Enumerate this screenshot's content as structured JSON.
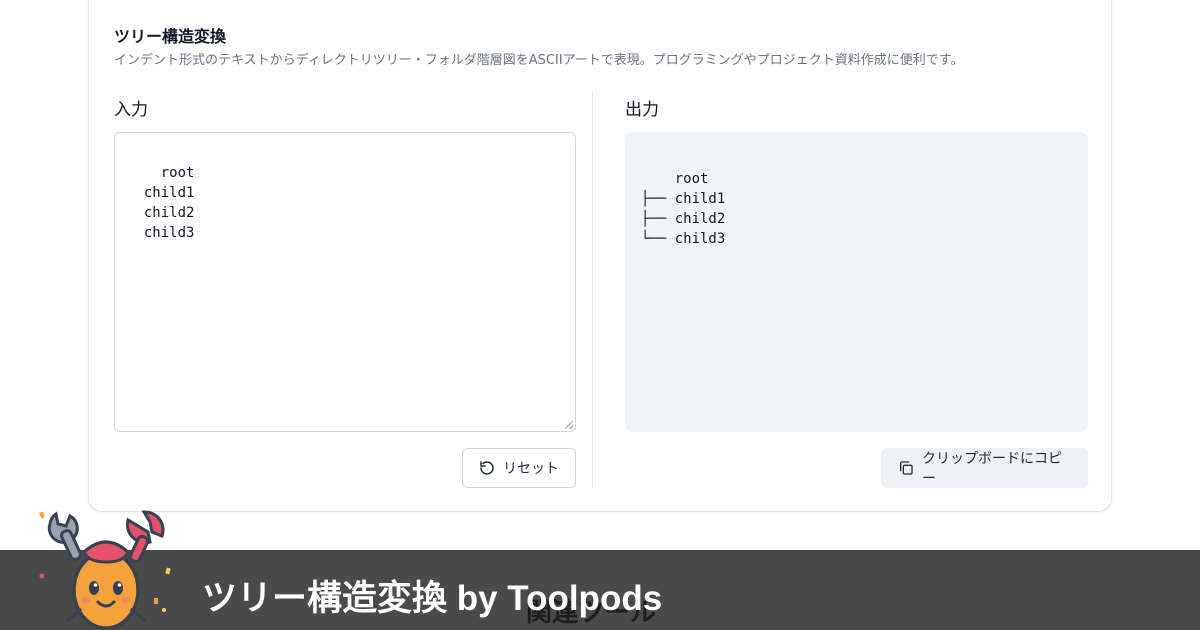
{
  "tool": {
    "title": "ツリー構造変換",
    "description": "インデント形式のテキストからディレクトリツリー・フォルダ階層図をASCIIアートで表現。プログラミングやプロジェクト資料作成に便利です。"
  },
  "input": {
    "label": "入力",
    "value": "root\n  child1\n  child2\n  child3"
  },
  "output": {
    "label": "出力",
    "value": "root\n├── child1\n├── child2\n└── child3"
  },
  "buttons": {
    "reset_label": "リセット",
    "copy_label": "クリップボードにコピー"
  },
  "banner": {
    "title": "ツリー構造変換 by Toolpods",
    "related": "関連ツール"
  },
  "colors": {
    "banner_bg": "#4a4a4a",
    "output_bg": "#f1f4f8",
    "mascot_body": "#f5a23c",
    "mascot_claw": "#9aa3ad",
    "mascot_accent": "#e2536a"
  }
}
